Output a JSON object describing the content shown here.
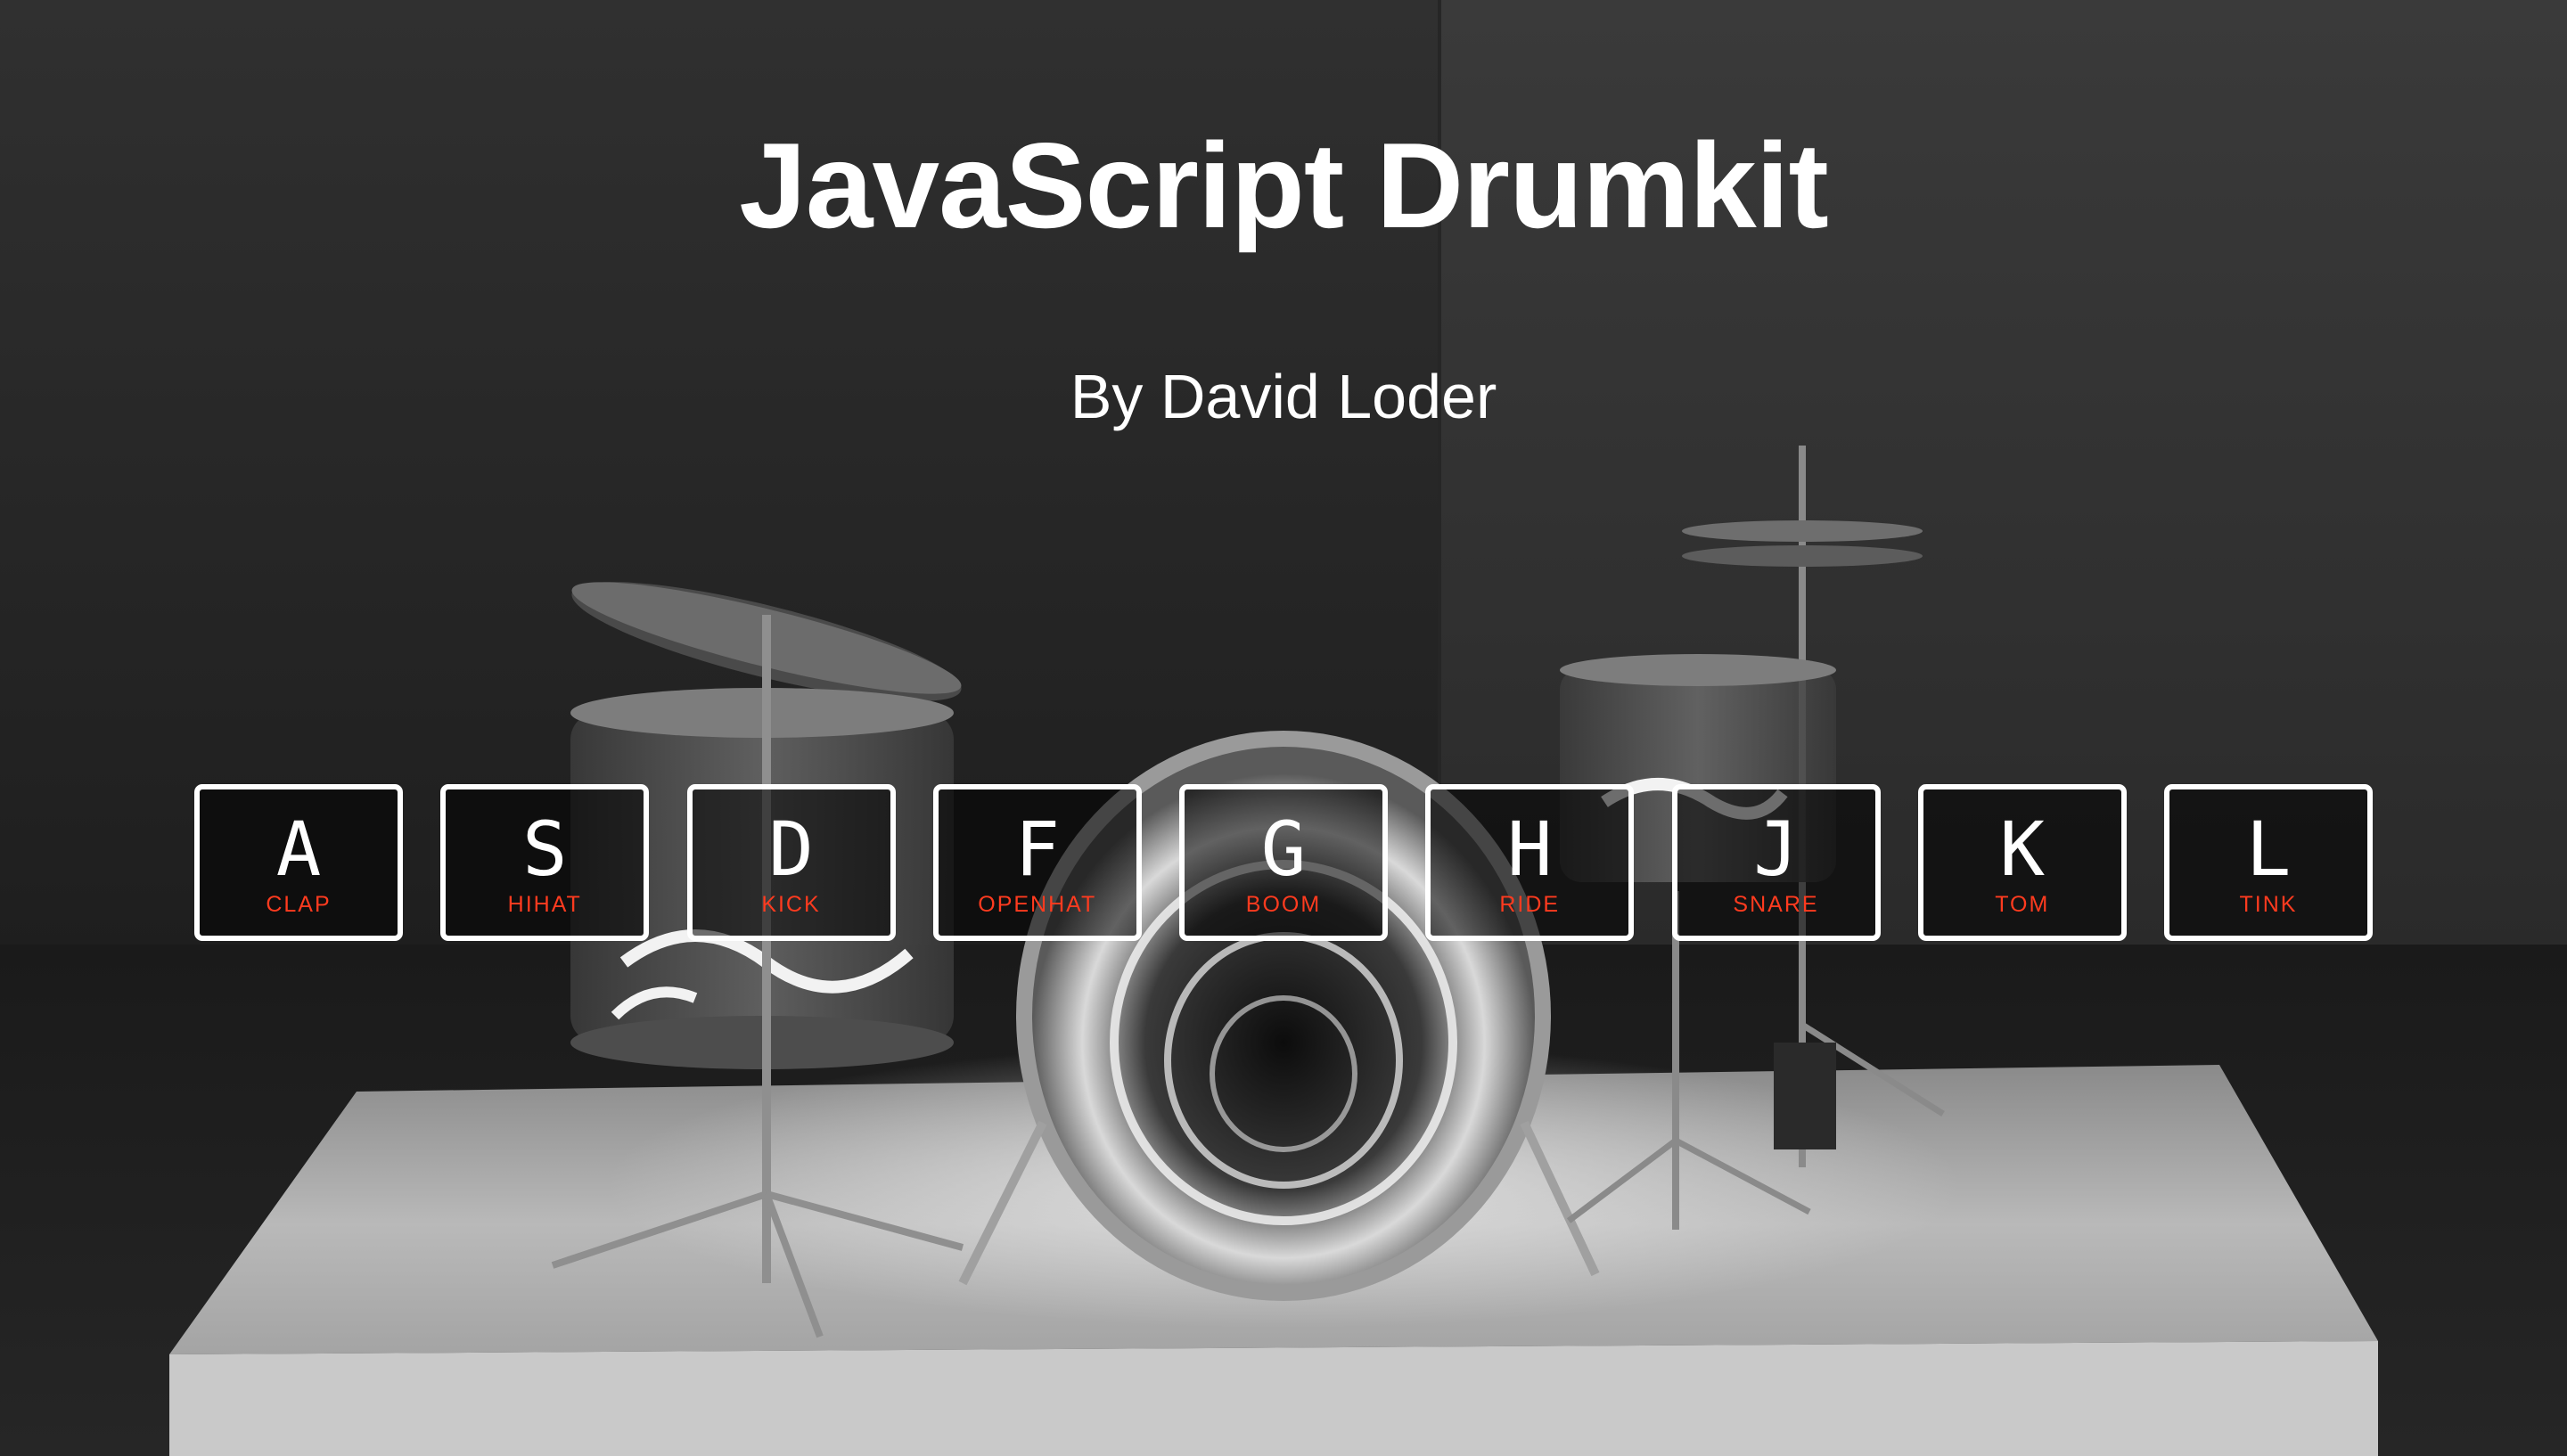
{
  "header": {
    "title": "JavaScript Drumkit",
    "subtitle": "By David Loder"
  },
  "keys": [
    {
      "letter": "A",
      "sound": "CLAP"
    },
    {
      "letter": "S",
      "sound": "HIHAT"
    },
    {
      "letter": "D",
      "sound": "KICK"
    },
    {
      "letter": "F",
      "sound": "OPENHAT"
    },
    {
      "letter": "G",
      "sound": "BOOM"
    },
    {
      "letter": "H",
      "sound": "RIDE"
    },
    {
      "letter": "J",
      "sound": "SNARE"
    },
    {
      "letter": "K",
      "sound": "TOM"
    },
    {
      "letter": "L",
      "sound": "TINK"
    }
  ],
  "colors": {
    "key_border": "#ffffff",
    "key_sound_label": "#ff3b1f",
    "text": "#ffffff",
    "background": "#1f1f1f"
  }
}
